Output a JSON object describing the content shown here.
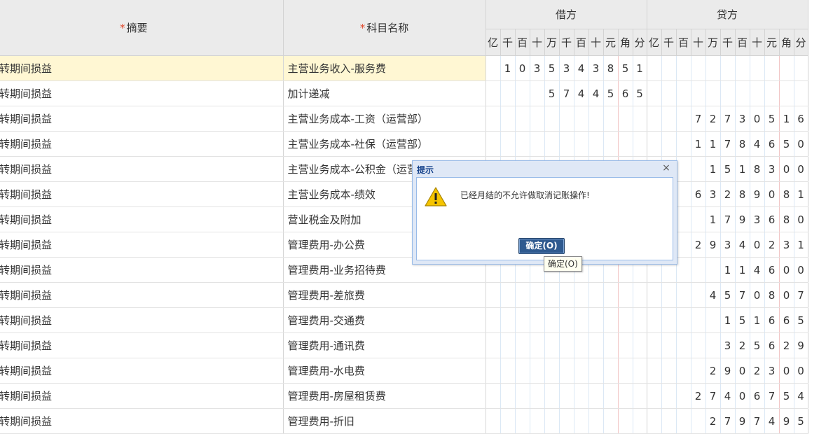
{
  "headers": {
    "required_mark": "*",
    "summary": "摘要",
    "account": "科目名称",
    "debit": "借方",
    "credit": "贷方",
    "digits": [
      "亿",
      "千",
      "百",
      "十",
      "万",
      "千",
      "百",
      "十",
      "元",
      "角",
      "分"
    ]
  },
  "rows": [
    {
      "summary": "结转期间损益",
      "account": "主营业务收入-服务费",
      "debit": "1035343851",
      "credit": ""
    },
    {
      "summary": "结转期间损益",
      "account": "加计递减",
      "debit": "5744565",
      "credit": ""
    },
    {
      "summary": "结转期间损益",
      "account": "主营业务成本-工资（运营部）",
      "debit": "",
      "credit": "7273051 6"
    },
    {
      "summary": "结转期间损益",
      "account": "主营业务成本-社保（运营部）",
      "debit": "",
      "credit": "11784650"
    },
    {
      "summary": "结转期间损益",
      "account": "主营业务成本-公积金（运营部）",
      "debit": "",
      "credit": "1518300"
    },
    {
      "summary": "结转期间损益",
      "account": "主营业务成本-绩效",
      "debit": "",
      "credit": "63289081"
    },
    {
      "summary": "结转期间损益",
      "account": "营业税金及附加",
      "debit": "",
      "credit": "1793680"
    },
    {
      "summary": "结转期间损益",
      "account": "管理费用-办公费",
      "debit": "",
      "credit": "29340231"
    },
    {
      "summary": "结转期间损益",
      "account": "管理费用-业务招待费",
      "debit": "",
      "credit": "114600"
    },
    {
      "summary": "结转期间损益",
      "account": "管理费用-差旅费",
      "debit": "",
      "credit": "4570807"
    },
    {
      "summary": "结转期间损益",
      "account": "管理费用-交通费",
      "debit": "",
      "credit": "151665"
    },
    {
      "summary": "结转期间损益",
      "account": "管理费用-通讯费",
      "debit": "",
      "credit": "325629"
    },
    {
      "summary": "结转期间损益",
      "account": "管理费用-水电费",
      "debit": "",
      "credit": "2902300"
    },
    {
      "summary": "结转期间损益",
      "account": "管理费用-房屋租赁费",
      "debit": "",
      "credit": "27406754"
    },
    {
      "summary": "结转期间损益",
      "account": "管理费用-折旧",
      "debit": "",
      "credit": "2797495"
    }
  ],
  "dialog": {
    "title": "提示",
    "close_symbol": "×",
    "message": "已经月结的不允许做取消记账操作!",
    "ok_label": "确定(O)",
    "tooltip": "确定(O)",
    "icon": "warning-icon"
  },
  "colors": {
    "header_bg": "#ebebeb",
    "highlight_row": "#fff7d3",
    "required": "#e0472a",
    "dialog_frame": "#dfe8f6",
    "ok_button": "#2f5a8f"
  }
}
